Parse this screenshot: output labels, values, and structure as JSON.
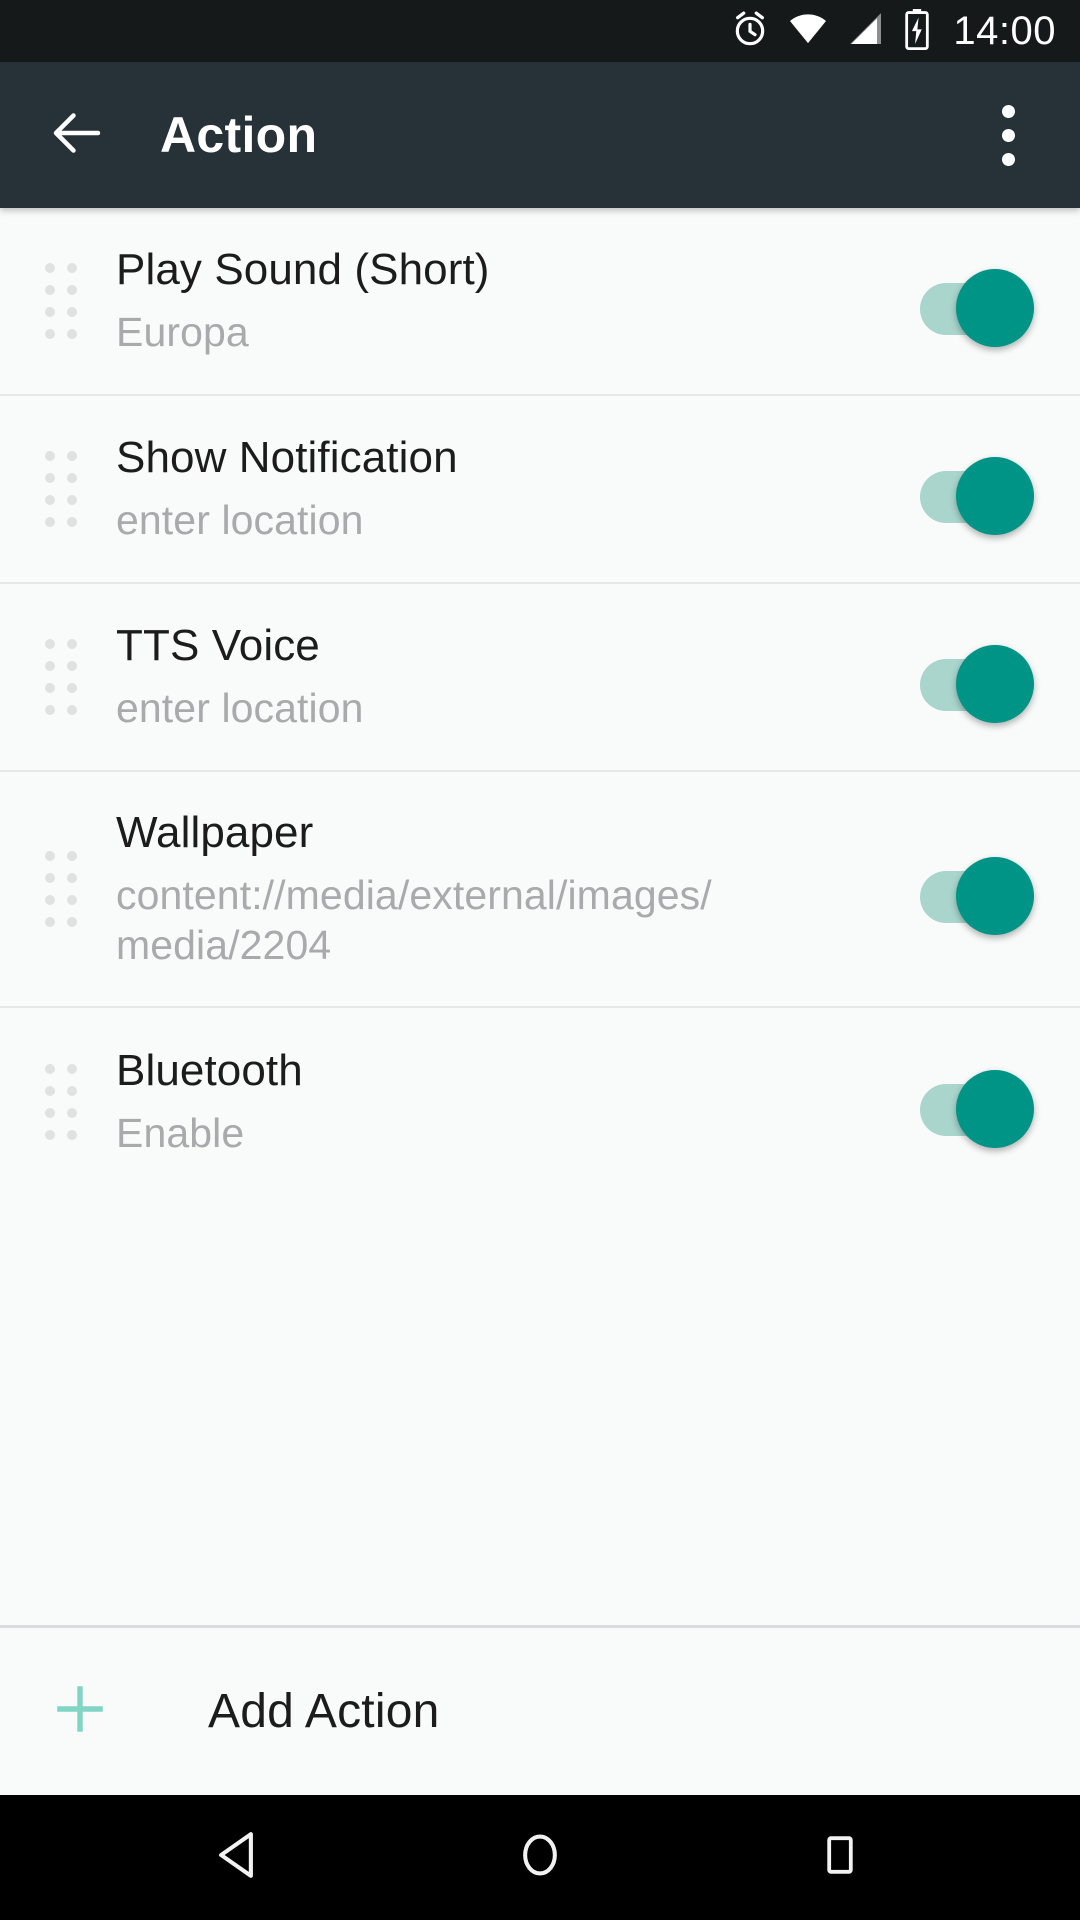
{
  "status_bar": {
    "time": "14:00",
    "icons": [
      "alarm-icon",
      "wifi-icon",
      "signal-icon",
      "battery-charging-icon"
    ],
    "background": "#16191a"
  },
  "app_bar": {
    "title": "Action",
    "back_icon": "arrow-left-icon",
    "overflow_icon": "more-vertical-icon",
    "background": "#263238"
  },
  "theme": {
    "accent": "#009486",
    "switch_track": "#a9d5cd",
    "plus_accent": "#80d5c4",
    "list_background": "#f9fafa",
    "divider": "#e6e8e8",
    "title_color": "#1c1c1c",
    "subtitle_color": "#a8aaab"
  },
  "actions": [
    {
      "title": "Play Sound (Short)",
      "subtitle": "Europa",
      "enabled": true,
      "handle": "drag-handle-icon"
    },
    {
      "title": "Show Notification",
      "subtitle": "enter location",
      "enabled": true,
      "handle": "drag-handle-icon"
    },
    {
      "title": "TTS Voice",
      "subtitle": "enter location",
      "enabled": true,
      "handle": "drag-handle-icon"
    },
    {
      "title": "Wallpaper",
      "subtitle": "content://media/external/images/media/2204",
      "enabled": true,
      "handle": "drag-handle-icon"
    },
    {
      "title": "Bluetooth",
      "subtitle": "Enable",
      "enabled": true,
      "handle": "drag-handle-icon"
    }
  ],
  "footer": {
    "add_label": "Add Action",
    "add_icon": "plus-icon"
  },
  "nav_bar": {
    "back": "back-triangle-icon",
    "home": "home-circle-icon",
    "recents": "recents-square-icon",
    "background": "#000000"
  }
}
